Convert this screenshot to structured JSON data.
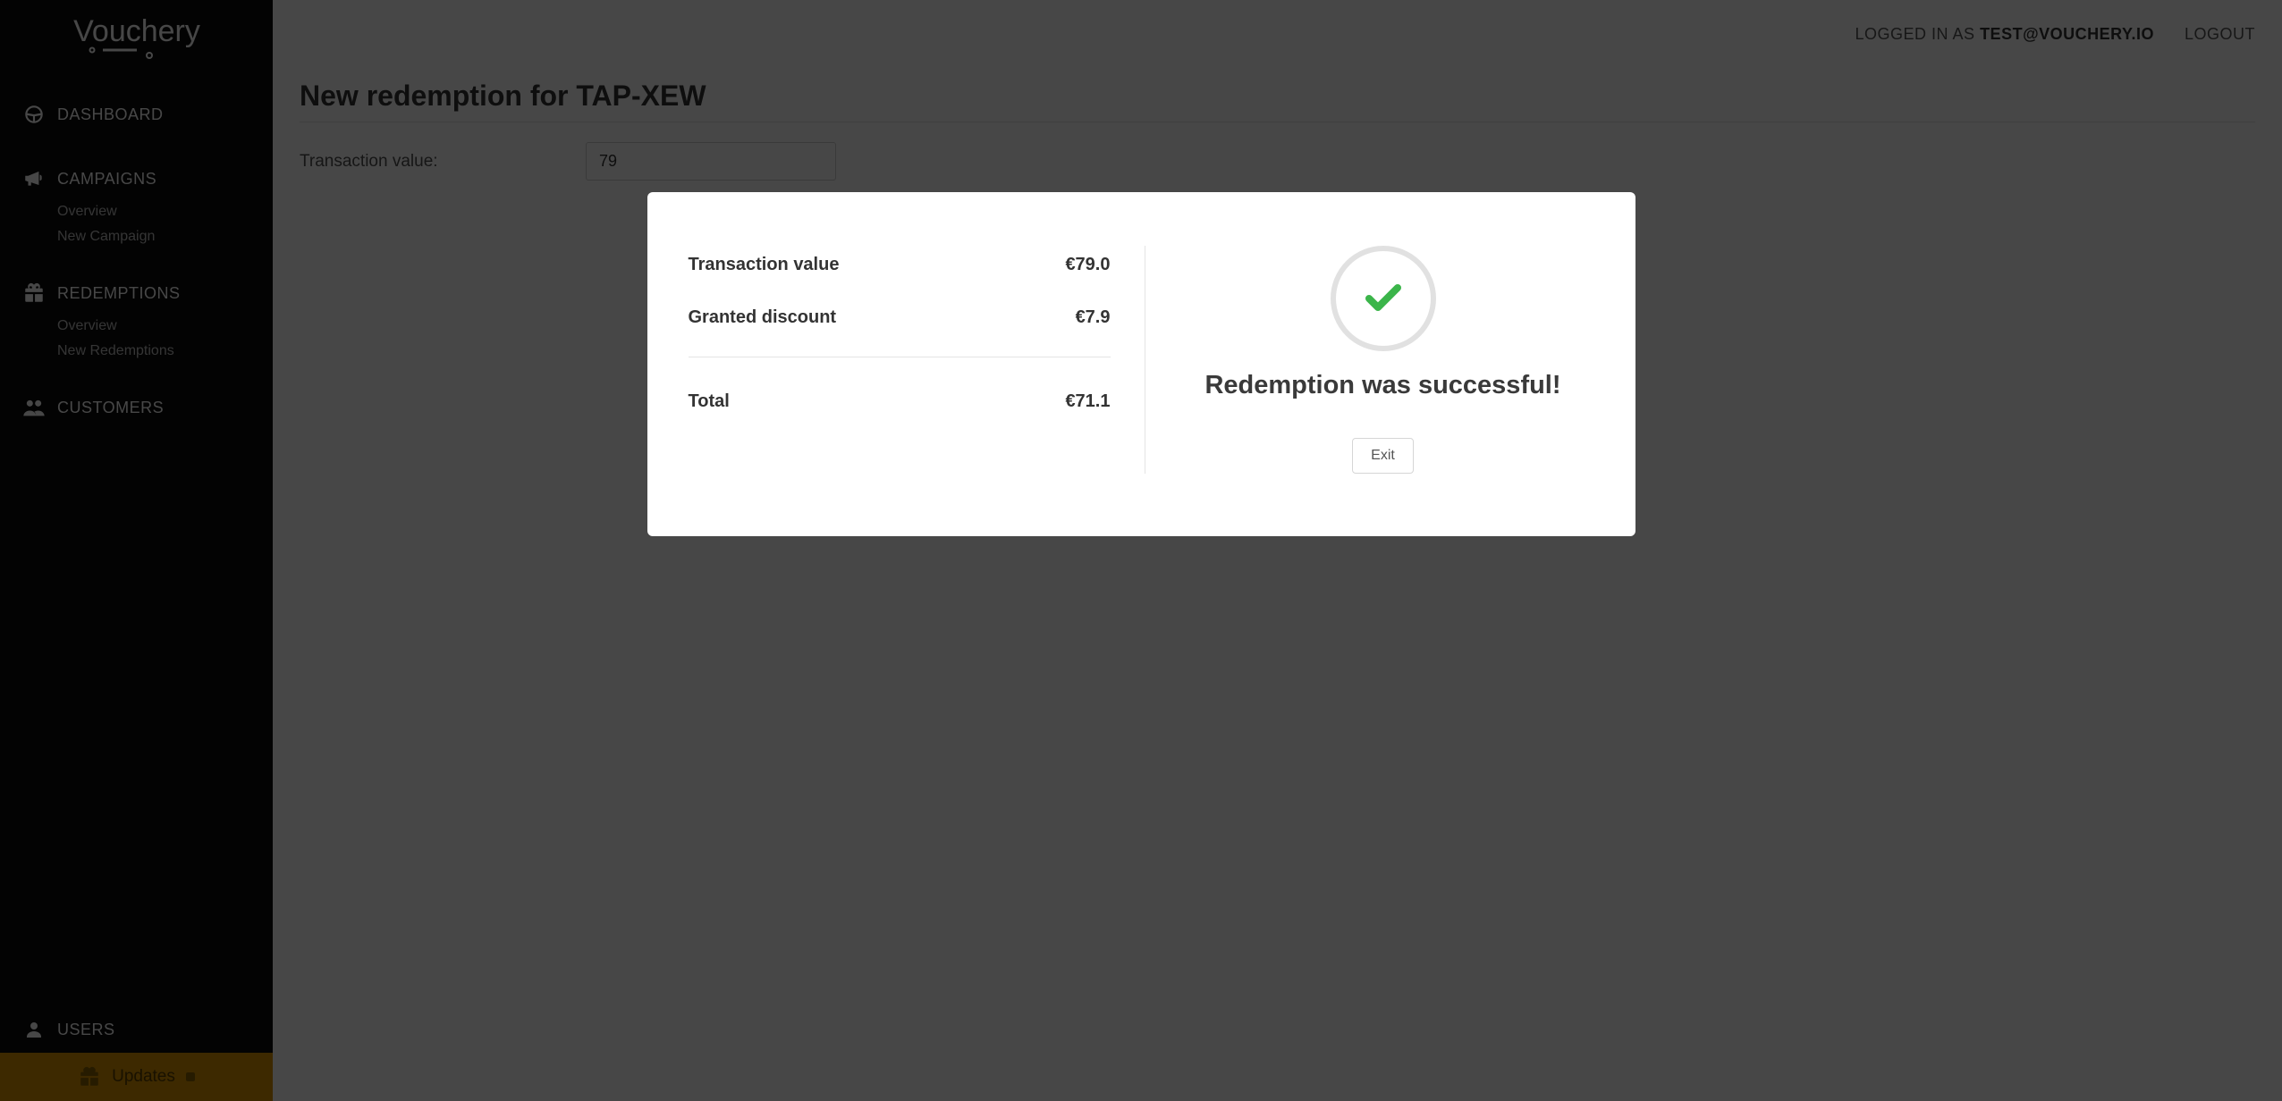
{
  "brand": {
    "name": "Vouchery"
  },
  "header": {
    "prefix": "LOGGED IN AS ",
    "email": "TEST@VOUCHERY.IO",
    "logout": "LOGOUT"
  },
  "sidebar": {
    "items": [
      {
        "label": "DASHBOARD",
        "icon": "dashboard-icon",
        "subs": []
      },
      {
        "label": "CAMPAIGNS",
        "icon": "megaphone-icon",
        "subs": [
          "Overview",
          "New Campaign"
        ]
      },
      {
        "label": "REDEMPTIONS",
        "icon": "gift-icon",
        "subs": [
          "Overview",
          "New Redemptions"
        ]
      },
      {
        "label": "CUSTOMERS",
        "icon": "customers-icon",
        "subs": []
      }
    ],
    "bottom": {
      "label": "USERS",
      "icon": "user-icon"
    },
    "updates": {
      "label": "Updates"
    }
  },
  "page": {
    "title": "New redemption for TAP-XEW",
    "transaction_label": "Transaction value:",
    "transaction_value": "79"
  },
  "modal": {
    "rows": [
      {
        "label": "Transaction value",
        "value": "€79.0"
      },
      {
        "label": "Granted discount",
        "value": "€7.9"
      }
    ],
    "total_label": "Total",
    "total_value": "€71.1",
    "success_title": "Redemption was successful!",
    "exit": "Exit"
  }
}
